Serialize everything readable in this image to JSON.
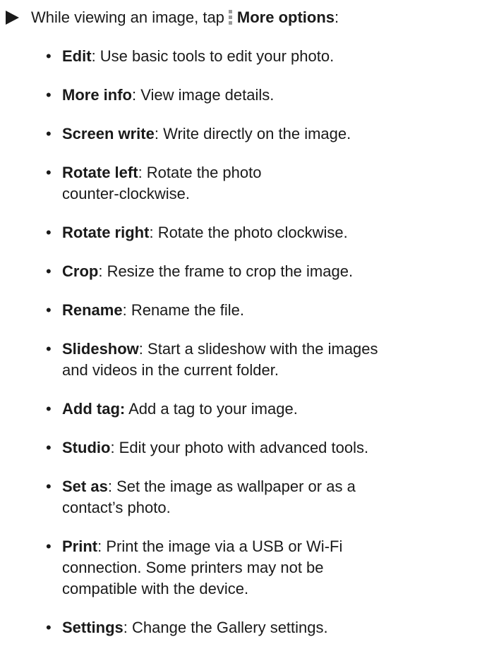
{
  "intro": {
    "prefix": "While viewing an image, tap",
    "button": "More options",
    "suffix": ":"
  },
  "icons": {
    "arrow": "right-pointer-arrow",
    "more_options": "more-options-vertical-dots"
  },
  "items": [
    {
      "term": "Edit",
      "sep": ": ",
      "desc": "Use basic tools to edit your photo."
    },
    {
      "term": "More info",
      "sep": ": ",
      "desc": "View image details."
    },
    {
      "term": "Screen write",
      "sep": ": ",
      "desc": "Write directly on the image."
    },
    {
      "term": "Rotate left",
      "sep": ": ",
      "desc": "Rotate the photo counter-clockwise."
    },
    {
      "term": "Rotate right",
      "sep": ": ",
      "desc": "Rotate the photo clockwise."
    },
    {
      "term": "Crop",
      "sep": ": ",
      "desc": "Resize the frame to crop the image."
    },
    {
      "term": "Rename",
      "sep": ": ",
      "desc": "Rename the file."
    },
    {
      "term": "Slideshow",
      "sep": ": ",
      "desc": "Start a slideshow with the images and videos in the current folder."
    },
    {
      "term": "Add tag:",
      "sep": " ",
      "desc": "Add a tag to your image."
    },
    {
      "term": "Studio",
      "sep": ": ",
      "desc": "Edit your photo with advanced tools."
    },
    {
      "term": "Set as",
      "sep": ": ",
      "desc": "Set the image as wallpaper or as a contact’s photo."
    },
    {
      "term": "Print",
      "sep": ": ",
      "desc": "Print the image via a USB or Wi-Fi connection. Some printers may not be compatible with the device."
    },
    {
      "term": "Settings",
      "sep": ": ",
      "desc": "Change the Gallery settings."
    }
  ]
}
